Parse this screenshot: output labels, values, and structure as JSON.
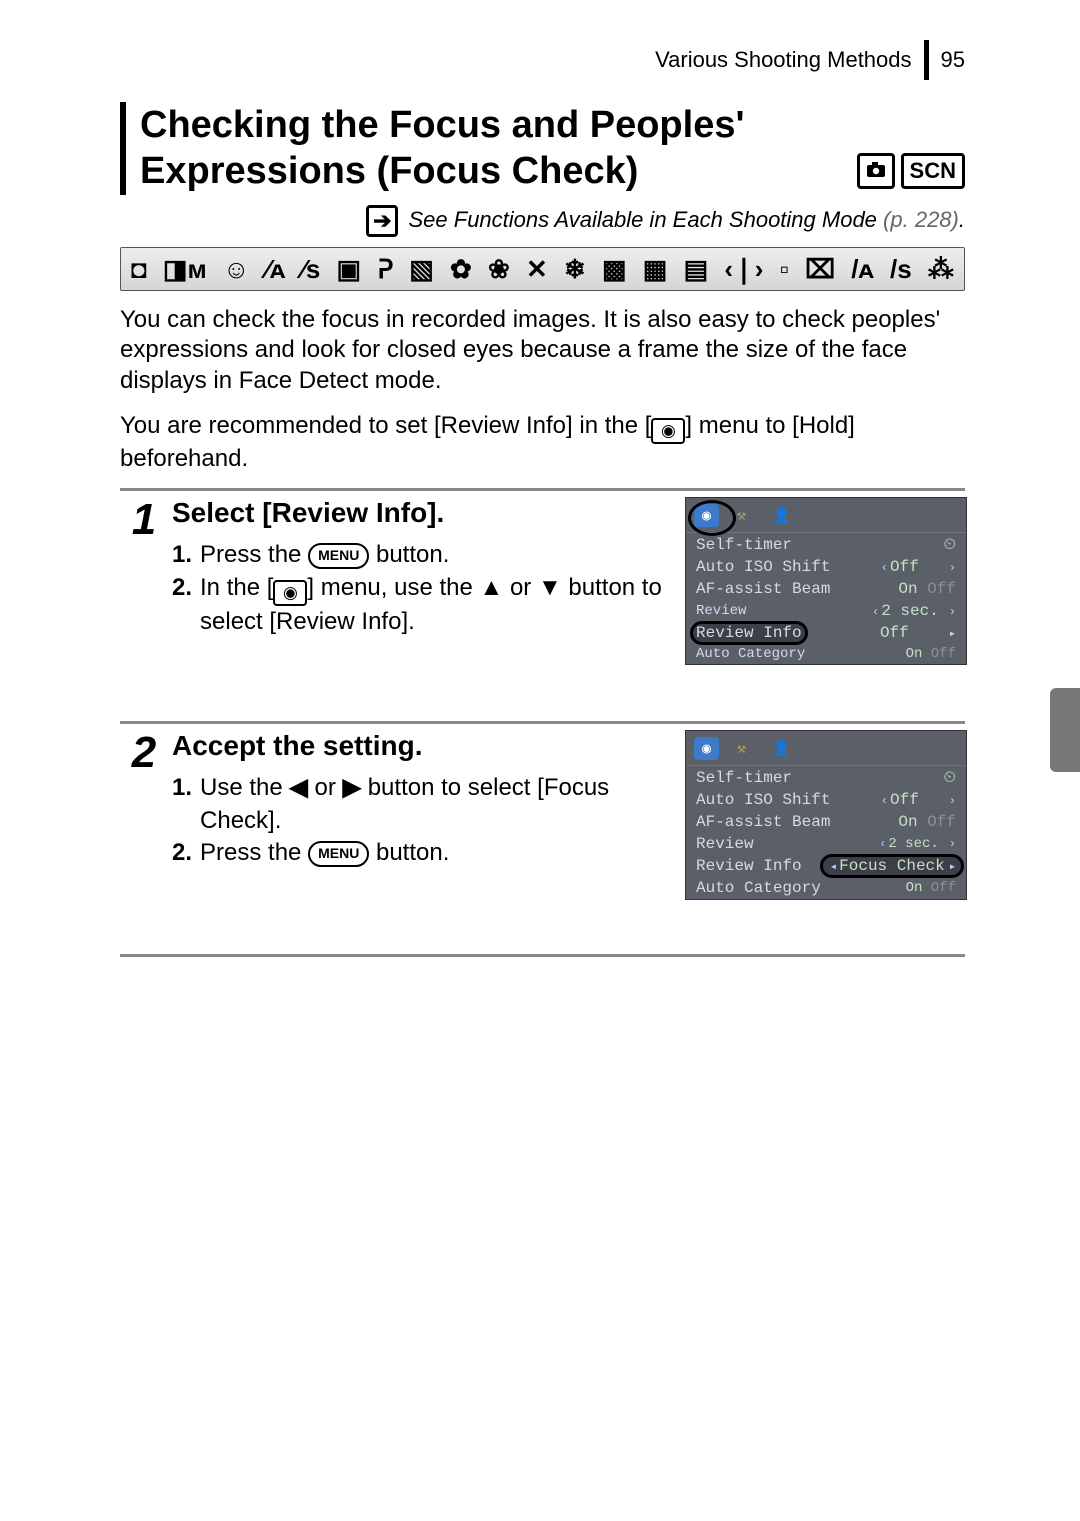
{
  "header": {
    "section": "Various Shooting Methods",
    "page_number": "95"
  },
  "title": "Checking the Focus and Peoples' Expressions (Focus Check)",
  "mode_badges": {
    "camera": "◉",
    "scn": "SCN"
  },
  "see_functions": {
    "text": "See Functions Available in Each Shooting Mode",
    "pref": "(p. 228)",
    "period": "."
  },
  "mode_strip": [
    "◘",
    "◨ᴍ",
    "☺",
    "⁄ᴀ",
    "⁄s",
    "▣",
    "ᕈ",
    "▧",
    "✿",
    "❀",
    "✕",
    "❄",
    "▩",
    "▦",
    "▤",
    "‹❘›",
    "▫",
    "⌧",
    "/ᴀ",
    "/s",
    "⁂"
  ],
  "paragraphs": {
    "p1": "You can check the focus in recorded images. It is also easy to check peoples' expressions and look for closed eyes because a frame the size of the face displays in Face Detect mode.",
    "p2a": "You are recommended to set [Review Info] in the [",
    "p2b": "] menu to [Hold] beforehand."
  },
  "steps": [
    {
      "num": "1",
      "title": "Select [Review Info].",
      "lines": {
        "l1": {
          "bn": "1.",
          "a": "Press the",
          "b": "button."
        },
        "l2": {
          "bn": "2.",
          "a": "In the [",
          "b": "] menu, use the",
          "c": "or",
          "d": "button to select [Review Info]."
        }
      },
      "lcd": {
        "tabs": {
          "cam": "◉",
          "tools": "⚒",
          "user": "👤"
        },
        "rows": [
          {
            "lab": "Self-timer",
            "val": "⏲"
          },
          {
            "lab": "Auto ISO Shift",
            "val": "Off",
            "caretL": "‹",
            "caretR": "›"
          },
          {
            "lab": "AF-assist Beam",
            "val": "On",
            "val2": "Off"
          },
          {
            "lab": "Review",
            "val": "2 sec.",
            "caretL": "‹",
            "caretR": "›"
          },
          {
            "lab": "Review Info",
            "val": "Off",
            "caretR": "▸",
            "highlight": "label"
          },
          {
            "lab": "Auto Category",
            "val": "On",
            "val2": "Off"
          }
        ]
      }
    },
    {
      "num": "2",
      "title": "Accept the setting.",
      "lines": {
        "l1": {
          "bn": "1.",
          "a": "Use the",
          "b": "or",
          "c": "button to select [Focus Check]."
        },
        "l2": {
          "bn": "2.",
          "a": "Press the",
          "b": "button."
        }
      },
      "lcd": {
        "tabs": {
          "cam": "◉",
          "tools": "⚒",
          "user": "👤"
        },
        "rows": [
          {
            "lab": "Self-timer",
            "val": "⏲"
          },
          {
            "lab": "Auto ISO Shift",
            "val": "Off",
            "caretL": "‹",
            "caretR": "›"
          },
          {
            "lab": "AF-assist Beam",
            "val": "On",
            "val2": "Off"
          },
          {
            "lab": "Review",
            "val": "2 sec.",
            "caretL": "‹",
            "caretR": "›"
          },
          {
            "lab": "Review Info",
            "val": "Focus Check",
            "caretL": "◂",
            "caretR": "▸",
            "highlight": "value"
          },
          {
            "lab": "Auto Category",
            "val": "On",
            "val2": "Off"
          }
        ]
      }
    }
  ],
  "buttons": {
    "menu": "MENU"
  },
  "arrows": {
    "up": "✦",
    "down": "✦",
    "left": "✦",
    "right": "✦"
  }
}
